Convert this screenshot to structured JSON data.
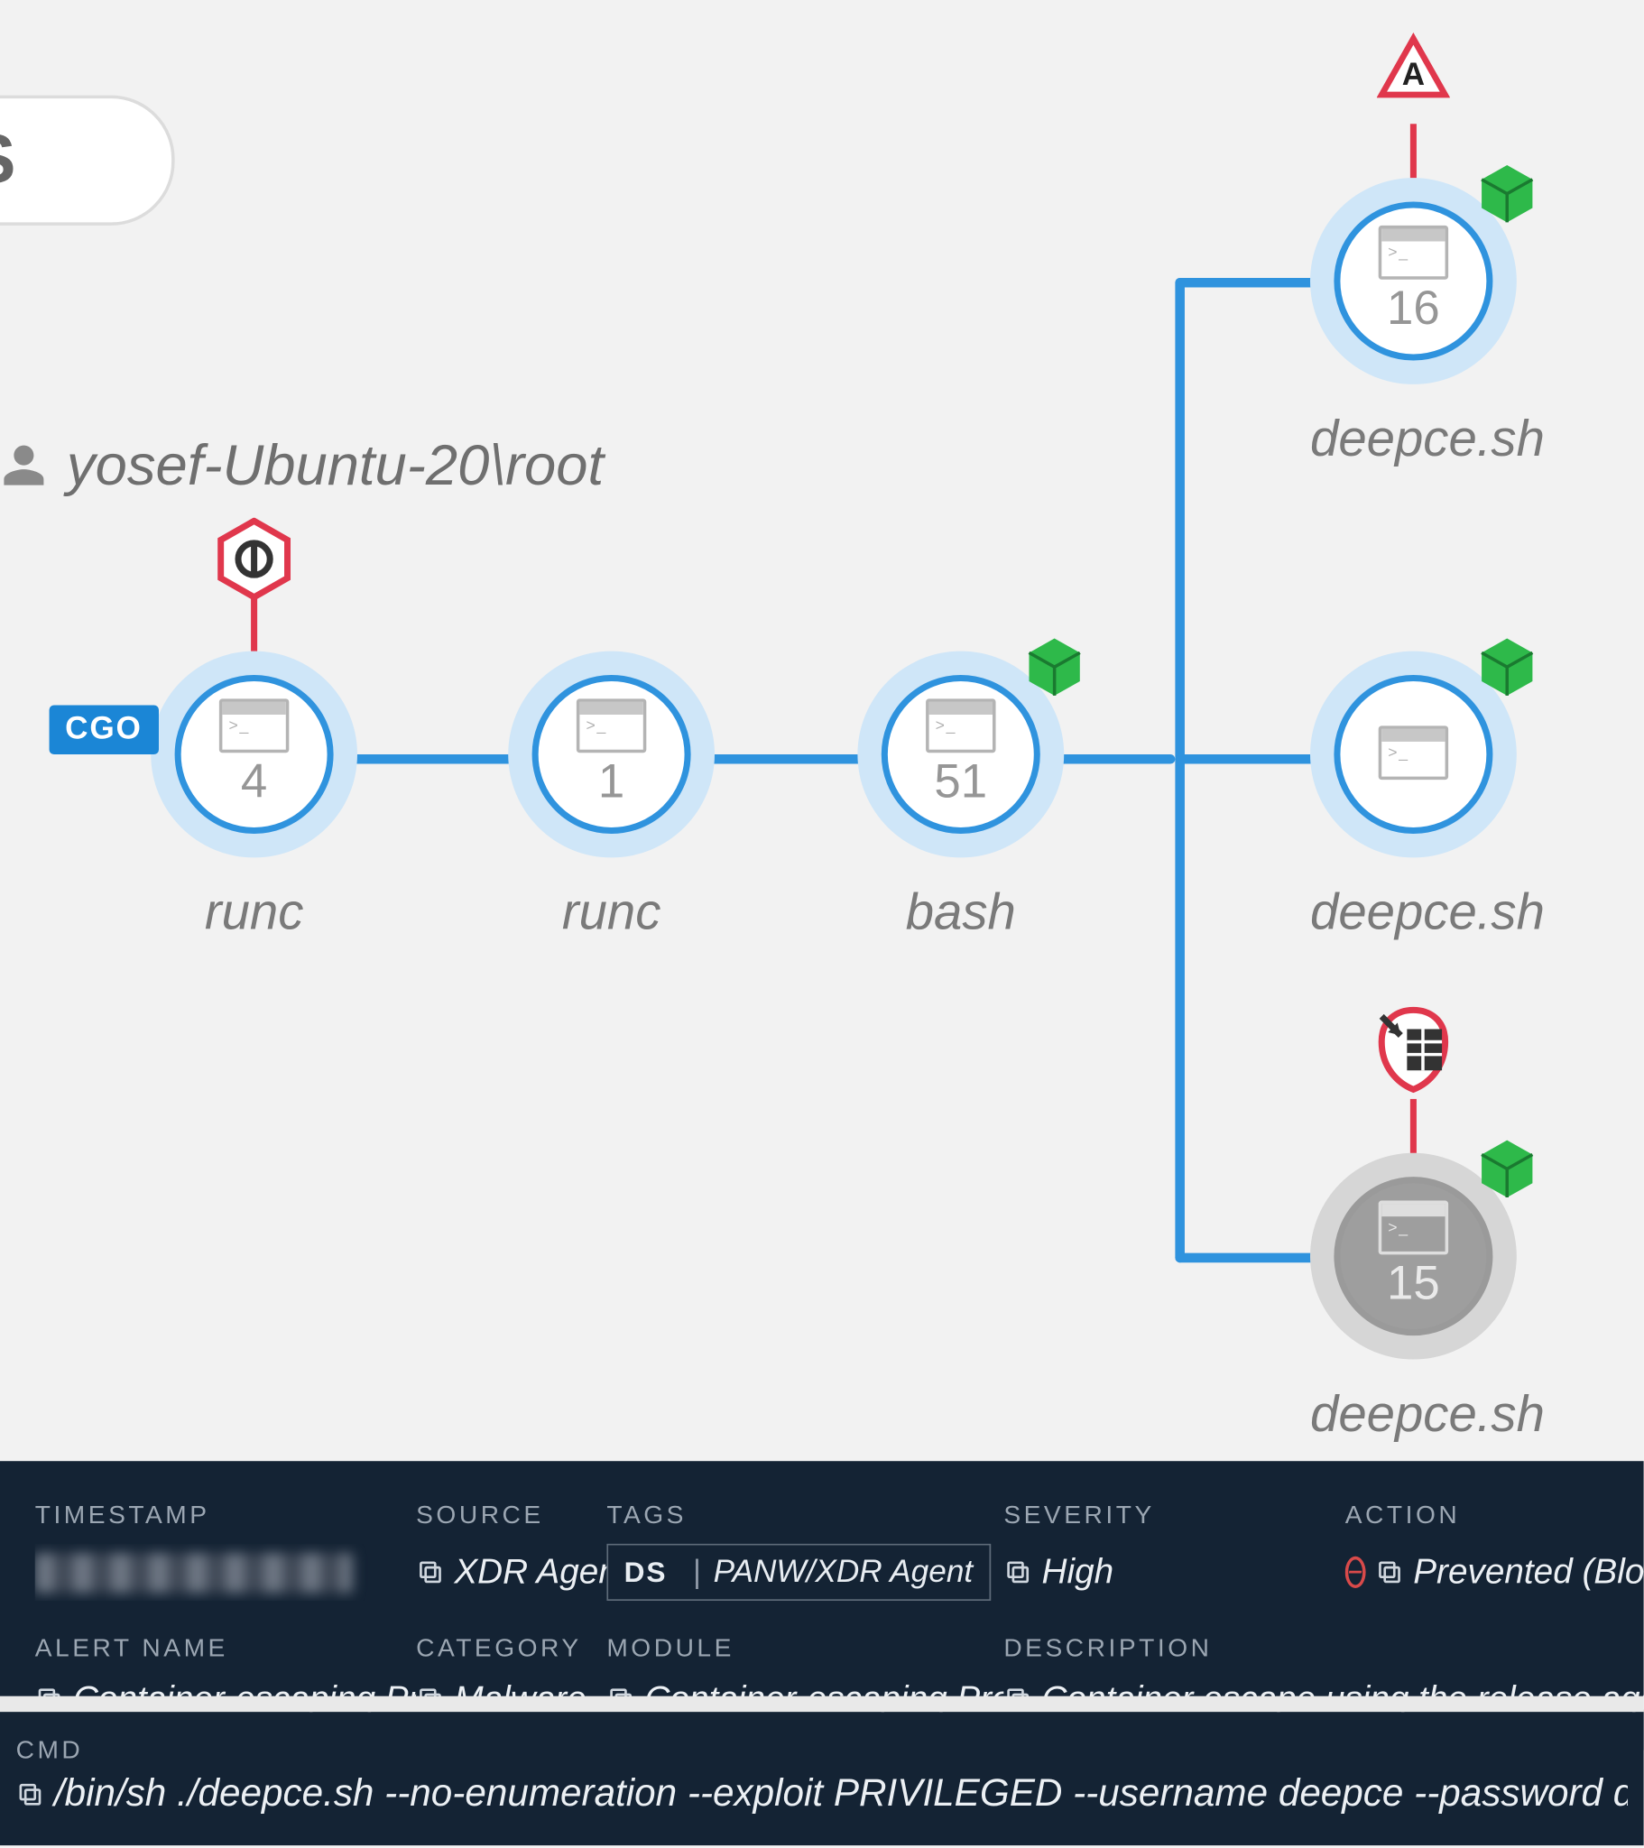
{
  "context": {
    "chip_letter": "S",
    "host": "yosef-Ubuntu-20\\root"
  },
  "graph": {
    "cgo_tag": "CGO",
    "nodes": {
      "runc1": {
        "label": "runc",
        "count": "4"
      },
      "runc2": {
        "label": "runc",
        "count": "1"
      },
      "bash": {
        "label": "bash",
        "count": "51"
      },
      "deep_top": {
        "label": "deepce.sh",
        "count": "16"
      },
      "deep_mid": {
        "label": "deepce.sh",
        "count": ""
      },
      "deep_bot": {
        "label": "deepce.sh",
        "count": "15"
      }
    },
    "top_badge_letter": "A"
  },
  "alert": {
    "labels": {
      "timestamp": "TIMESTAMP",
      "source": "SOURCE",
      "tags": "TAGS",
      "severity": "SEVERITY",
      "action": "ACTION",
      "alert_name": "ALERT NAME",
      "category": "CATEGORY",
      "module": "MODULE",
      "description": "DESCRIPTION",
      "cmd": "CMD"
    },
    "source": "XDR Agent",
    "tag_prefix": "DS",
    "tag_value": "PANW/XDR Agent",
    "severity": "High",
    "action": "Prevented (Blocked)",
    "alert_name": "Container-escaping Protecti…",
    "category": "Malware",
    "module": "Container-escaping Protection",
    "description": "Container escape using the release agent user mode helper",
    "cmd": "/bin/sh ./deepce.sh --no-enumeration --exploit PRIVILEGED --username deepce --password deepce"
  }
}
